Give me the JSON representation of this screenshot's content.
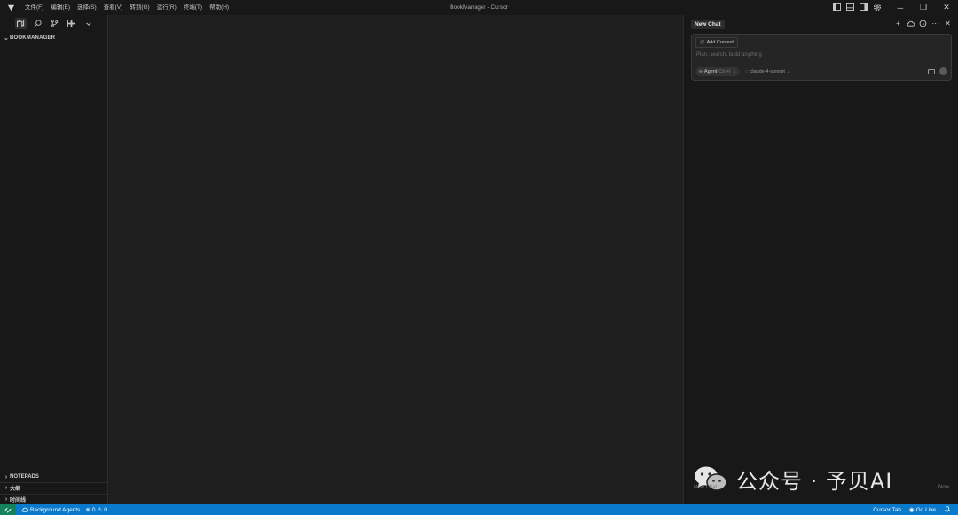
{
  "titlebar": {
    "menu": [
      "文件(F)",
      "编辑(E)",
      "选择(S)",
      "查看(V)",
      "转到(G)",
      "运行(R)",
      "终端(T)",
      "帮助(H)"
    ],
    "window_title": "BookManager - Cursor"
  },
  "sidebar": {
    "activity_icons": [
      "files-icon",
      "search-icon",
      "source-control-icon",
      "extensions-icon",
      "chevron-down-icon"
    ],
    "explorer_title": "BOOKMANAGER",
    "sections": [
      "NOTEPADS",
      "大纲",
      "时间线"
    ]
  },
  "chat": {
    "tab_label": "New Chat",
    "add_context_label": "Add Context",
    "placeholder": "Plan, search, build anything",
    "agent_label": "Agent",
    "agent_shortcut": "Ctrl+I",
    "model_label": "claude-4-sonnet"
  },
  "watermark": {
    "text": "公众号 · 予贝AI",
    "left_caption": "New Chat",
    "right_caption": "Now"
  },
  "statusbar": {
    "background_agents": "Background Agents",
    "errors": "0",
    "warnings": "0",
    "cursor_tab": "Cursor Tab",
    "go_live": "Go Live"
  },
  "colors": {
    "statusbar": "#0a7acc",
    "remote": "#16825d",
    "background": "#1e1e1e"
  }
}
